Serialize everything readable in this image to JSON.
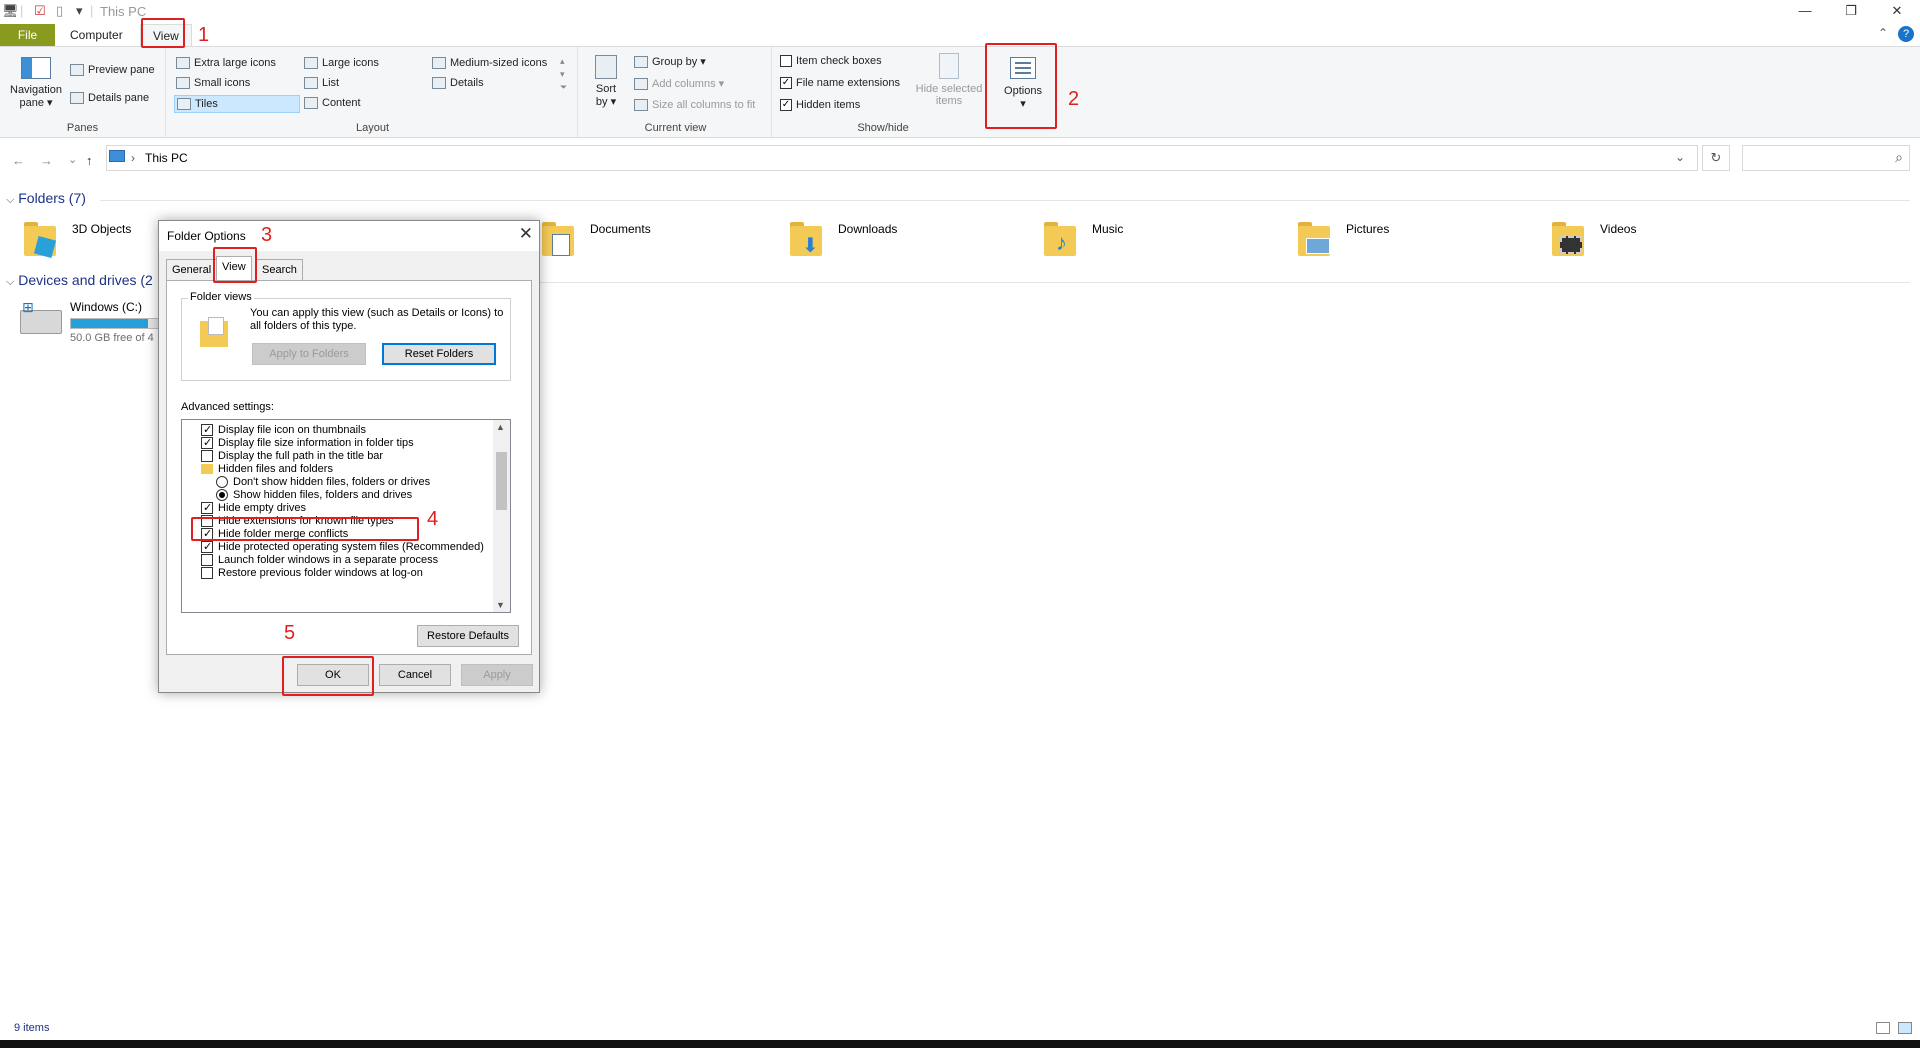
{
  "window": {
    "title": "This PC",
    "minimize": "—",
    "restore": "❐",
    "close": "✕"
  },
  "ribbon_tabs": [
    "File",
    "Computer",
    "View"
  ],
  "ribbon": {
    "panes": {
      "label": "Panes",
      "navigation_pane_line1": "Navigation",
      "navigation_pane_line2": "pane ▾",
      "preview_pane": "Preview pane",
      "details_pane": "Details pane"
    },
    "layout": {
      "label": "Layout",
      "items": [
        "Extra large icons",
        "Large icons",
        "Medium-sized icons",
        "Small icons",
        "List",
        "Details",
        "Tiles",
        "Content"
      ]
    },
    "current_view": {
      "label": "Current view",
      "sort_by_line1": "Sort",
      "sort_by_line2": "by ▾",
      "group_by": "Group by ▾",
      "add_columns": "Add columns ▾",
      "size_all_columns": "Size all columns to fit"
    },
    "show_hide": {
      "label": "Show/hide",
      "item_check_boxes": "Item check boxes",
      "file_name_extensions": "File name extensions",
      "hidden_items": "Hidden items",
      "hide_selected_line1": "Hide selected",
      "hide_selected_line2": "items",
      "options": "Options",
      "options_arrow": "▾"
    }
  },
  "address": {
    "back": "←",
    "forward": "→",
    "recent": "⌄",
    "up": "↑",
    "separator": "›",
    "path": "This PC",
    "dropdown": "⌄",
    "refresh": "↻",
    "search_icon": "⌕"
  },
  "content": {
    "folders_header": "Folders (7)",
    "folders": [
      "3D Objects",
      "Documents",
      "Downloads",
      "Music",
      "Pictures",
      "Videos"
    ],
    "devices_header": "Devices and drives (2",
    "drive_name": "Windows (C:)",
    "drive_free": "50.0 GB free of 4",
    "drive_usage_fraction": 0.87
  },
  "dialog": {
    "title": "Folder Options",
    "close": "✕",
    "tabs": [
      "General",
      "View",
      "Search"
    ],
    "folder_views": {
      "legend": "Folder views",
      "description": "You can apply this view (such as Details or Icons) to all folders of this type.",
      "apply_to_folders": "Apply to Folders",
      "reset_folders": "Reset Folders"
    },
    "advanced_label": "Advanced settings:",
    "advanced_items": [
      {
        "text": "Display file icon on thumbnails",
        "kind": "check",
        "checked": true
      },
      {
        "text": "Display file size information in folder tips",
        "kind": "check",
        "checked": true
      },
      {
        "text": "Display the full path in the title bar",
        "kind": "check",
        "checked": false
      },
      {
        "text": "Hidden files and folders",
        "kind": "folder",
        "checked": false
      },
      {
        "text": "Don't show hidden files, folders or drives",
        "kind": "radio",
        "checked": false
      },
      {
        "text": "Show hidden files, folders and drives",
        "kind": "radio",
        "checked": true
      },
      {
        "text": "Hide empty drives",
        "kind": "check",
        "checked": true
      },
      {
        "text": "Hide extensions for known file types",
        "kind": "check",
        "checked": false
      },
      {
        "text": "Hide folder merge conflicts",
        "kind": "check",
        "checked": true
      },
      {
        "text": "Hide protected operating system files (Recommended)",
        "kind": "check",
        "checked": true
      },
      {
        "text": "Launch folder windows in a separate process",
        "kind": "check",
        "checked": false
      },
      {
        "text": "Restore previous folder windows at log-on",
        "kind": "check",
        "checked": false
      }
    ],
    "restore_defaults": "Restore Defaults",
    "ok": "OK",
    "cancel": "Cancel",
    "apply": "Apply"
  },
  "annotations": [
    "1",
    "2",
    "3",
    "4",
    "5"
  ],
  "status": {
    "items": "9 items"
  },
  "colors": {
    "file_tab": "#8a9a1f",
    "annotation": "#e02020",
    "link": "#1e3287",
    "drive_bar": "#26a0da"
  }
}
